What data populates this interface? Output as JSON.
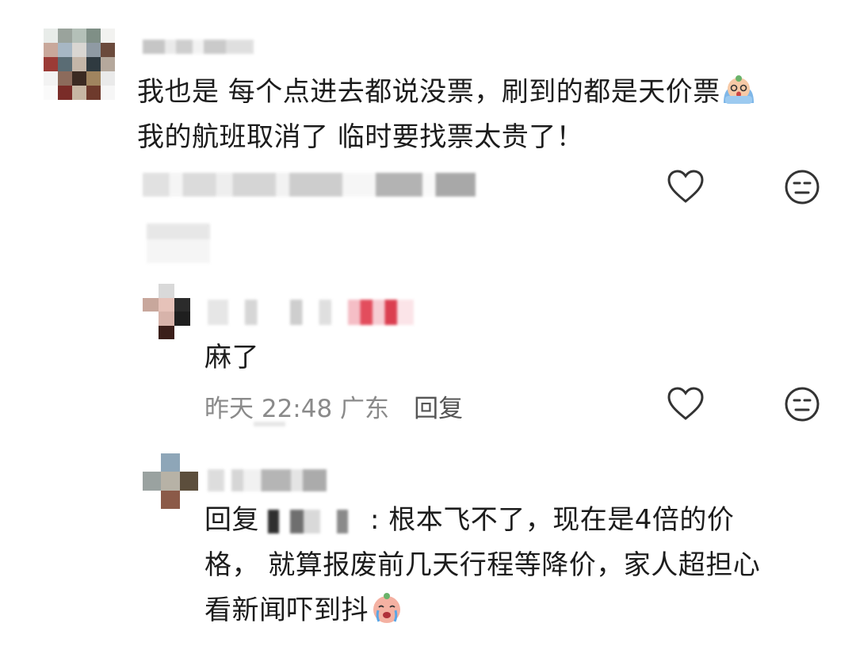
{
  "comments": [
    {
      "text_line1": "我也是 每个点进去都说没票，刷到的都是天价票",
      "text_line2": "我的航班取消了 临时要找票太贵了！",
      "emoji": "crying-face-emoji"
    },
    {
      "text": "麻了",
      "time": "昨天 22:48 广东",
      "reply_label": "回复"
    },
    {
      "reply_prefix": "回复",
      "text_line1": ": 根本飞不了，现在是4倍的价",
      "text_line2": "格， 就算报废前几天行程等降价，家人超担心",
      "text_line3": "看新闻吓到抖",
      "emoji": "crying-face-emoji"
    }
  ],
  "icons": {
    "like": "heart-outline-icon",
    "dislike": "meh-face-icon"
  }
}
